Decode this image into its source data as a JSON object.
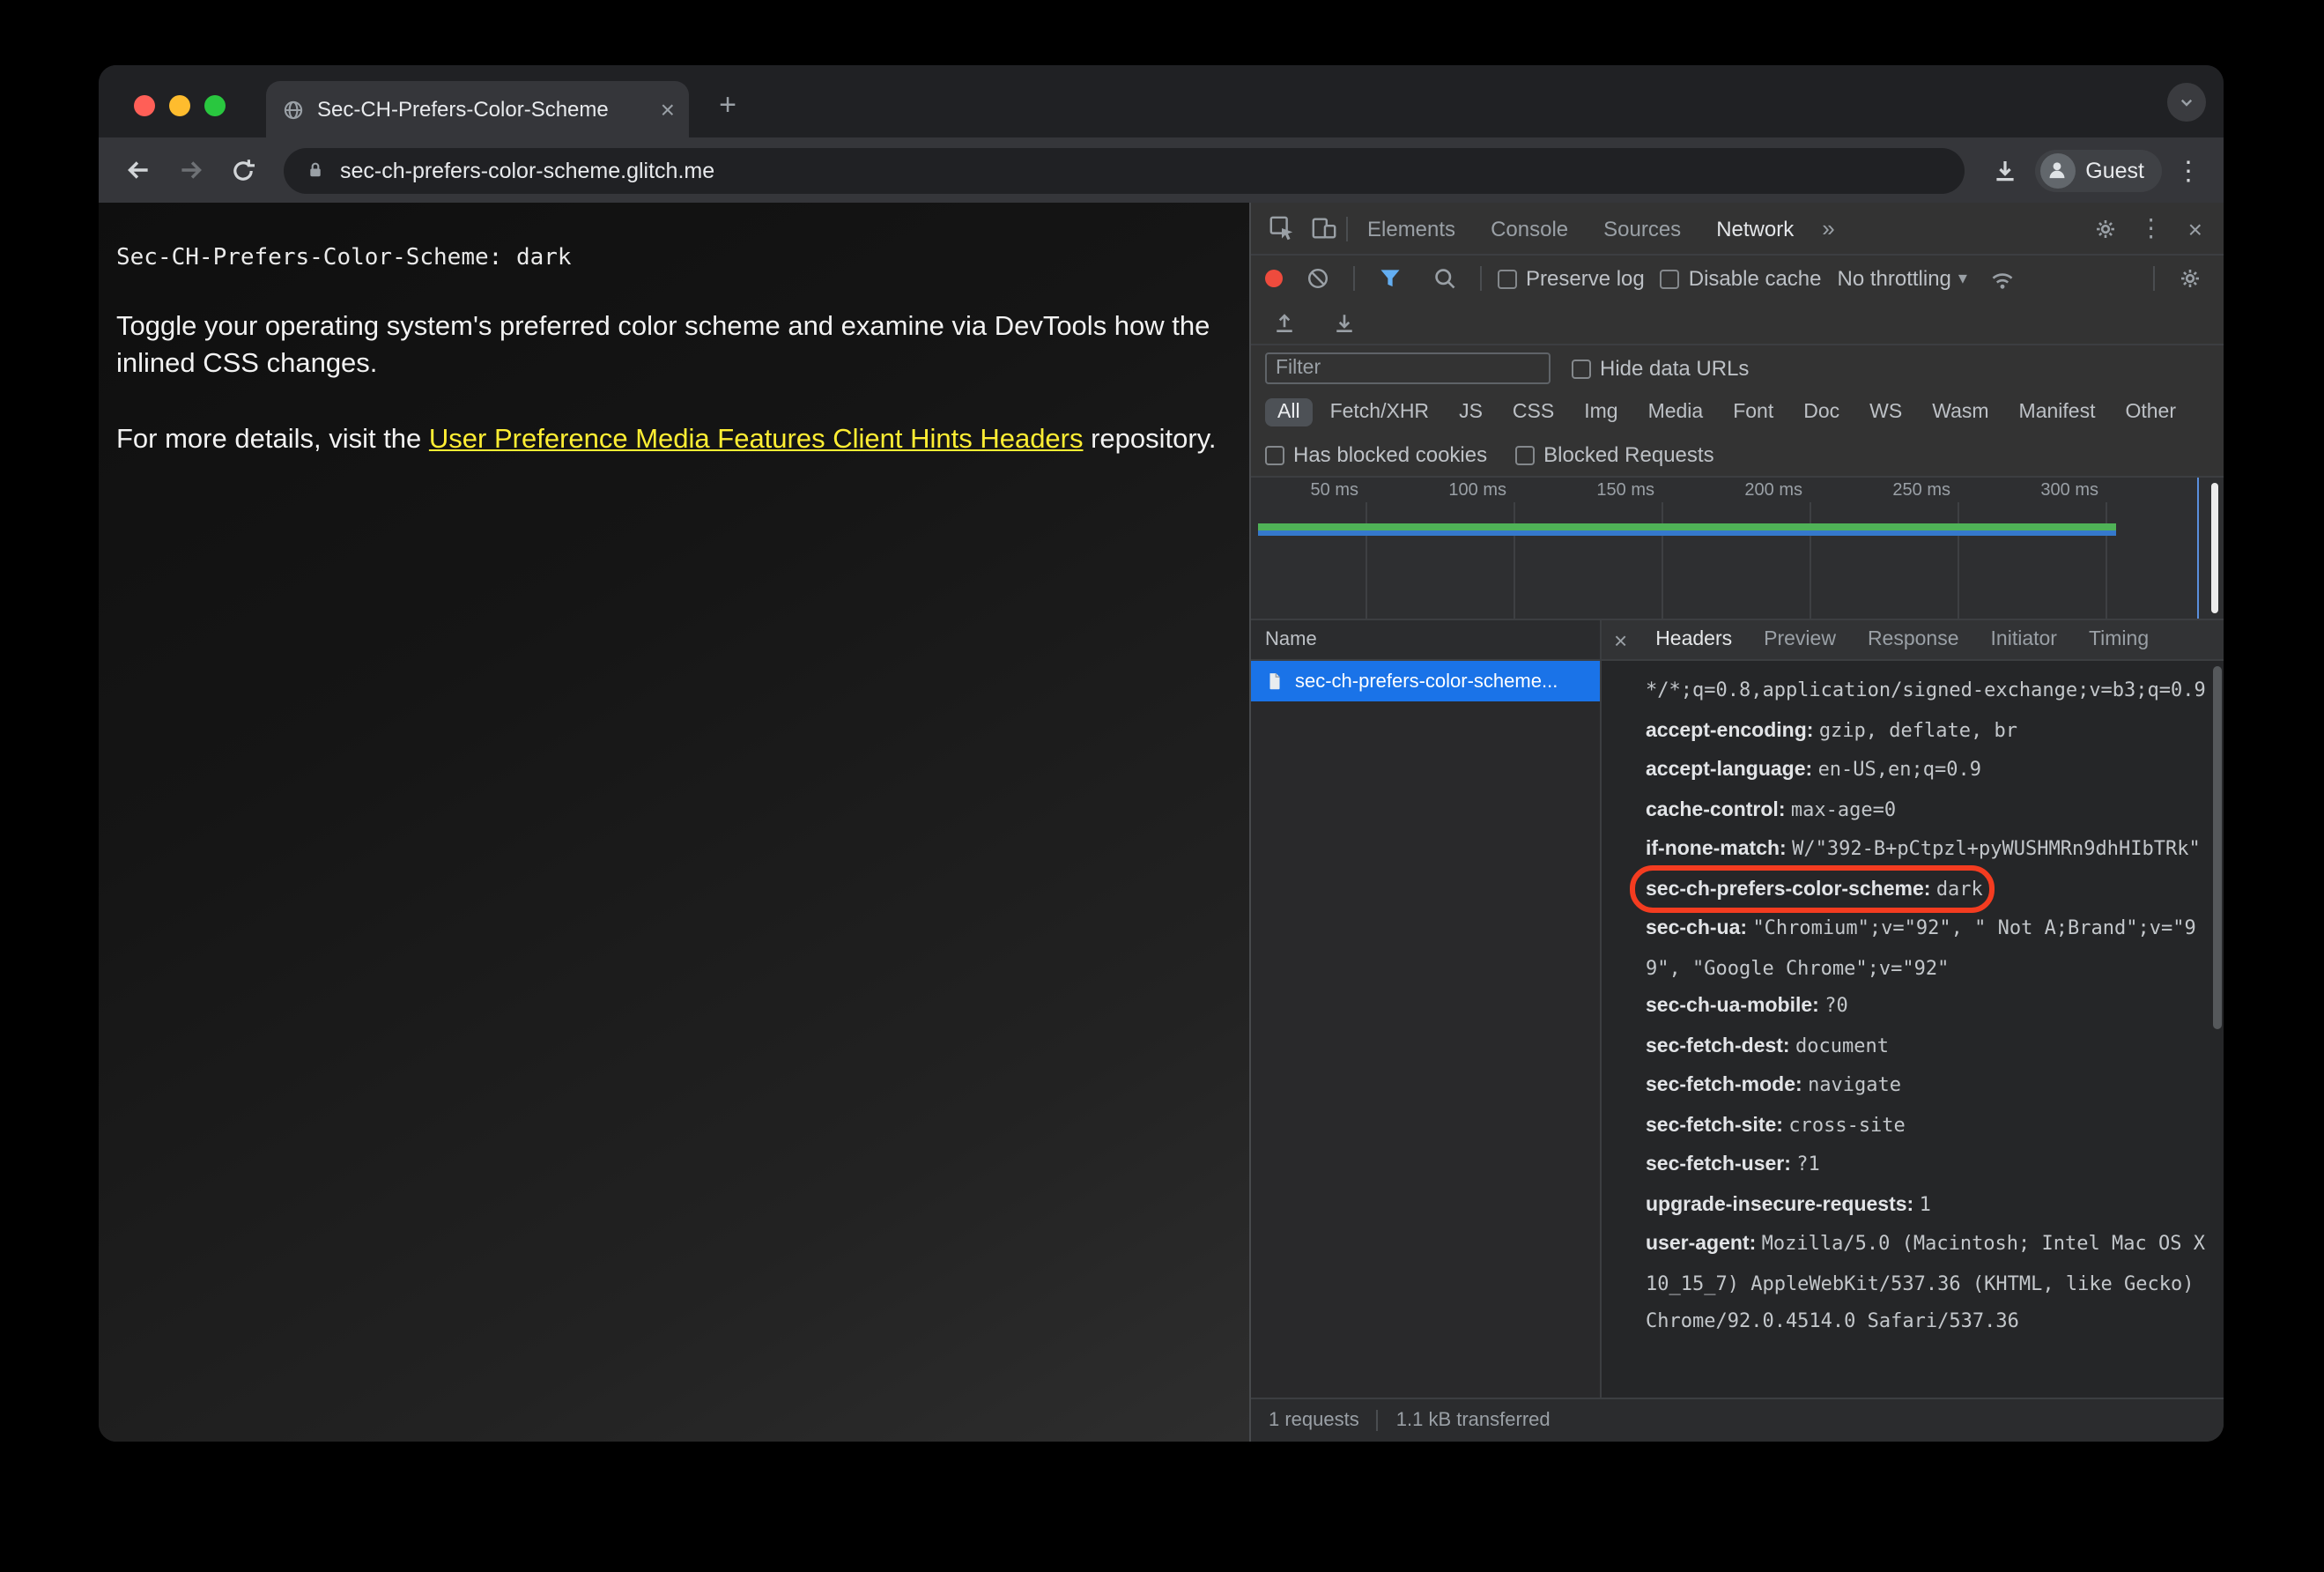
{
  "browser": {
    "tab_title": "Sec-CH-Prefers-Color-Scheme",
    "url": "sec-ch-prefers-color-scheme.glitch.me",
    "profile_label": "Guest"
  },
  "glyphs": {
    "close": "×",
    "plus": "+",
    "kebab": "⋮",
    "more_tabs": "»",
    "caret_down": "▾"
  },
  "page": {
    "heading_mono": "Sec-CH-Prefers-Color-Scheme: dark",
    "para1": "Toggle your operating system's preferred color scheme and examine via DevTools how the inlined CSS changes.",
    "para2_prefix": "For more details, visit the ",
    "para2_link": "User Preference Media Features Client Hints Headers",
    "para2_suffix": " repository."
  },
  "devtools": {
    "tabs": [
      "Elements",
      "Console",
      "Sources",
      "Network"
    ],
    "net": {
      "preserve_log": "Preserve log",
      "disable_cache": "Disable cache",
      "throttling": "No throttling",
      "filter_placeholder": "Filter",
      "hide_data_urls": "Hide data URLs",
      "has_blocked_cookies": "Has blocked cookies",
      "blocked_requests": "Blocked Requests",
      "pills": [
        "All",
        "Fetch/XHR",
        "JS",
        "CSS",
        "Img",
        "Media",
        "Font",
        "Doc",
        "WS",
        "Wasm",
        "Manifest",
        "Other"
      ],
      "ticks": [
        "50 ms",
        "100 ms",
        "150 ms",
        "200 ms",
        "250 ms",
        "300 ms"
      ],
      "name_column": "Name",
      "request_name": "sec-ch-prefers-color-scheme...",
      "summary_requests": "1 requests",
      "summary_transferred": "1.1 kB transferred"
    },
    "detail": {
      "tabs": [
        "Headers",
        "Preview",
        "Response",
        "Initiator",
        "Timing"
      ],
      "headers": [
        {
          "n": "",
          "v": "*/*;q=0.8,application/signed-exchange;v=b3;q=0.9"
        },
        {
          "n": "accept-encoding: ",
          "v": "gzip, deflate, br"
        },
        {
          "n": "accept-language: ",
          "v": "en-US,en;q=0.9"
        },
        {
          "n": "cache-control: ",
          "v": "max-age=0"
        },
        {
          "n": "if-none-match: ",
          "v": "W/\"392-B+pCtpzl+pyWUSHMRn9dhHIbTRk\""
        },
        {
          "n": "sec-ch-prefers-color-scheme: ",
          "v": "dark"
        },
        {
          "n": "sec-ch-ua: ",
          "v": "\"Chromium\";v=\"92\", \" Not A;Brand\";v=\"99\", \"Google Chrome\";v=\"92\""
        },
        {
          "n": "sec-ch-ua-mobile: ",
          "v": "?0"
        },
        {
          "n": "sec-fetch-dest: ",
          "v": "document"
        },
        {
          "n": "sec-fetch-mode: ",
          "v": "navigate"
        },
        {
          "n": "sec-fetch-site: ",
          "v": "cross-site"
        },
        {
          "n": "sec-fetch-user: ",
          "v": "?1"
        },
        {
          "n": "upgrade-insecure-requests: ",
          "v": "1"
        },
        {
          "n": "user-agent: ",
          "v": "Mozilla/5.0 (Macintosh; Intel Mac OS X 10_15_7) AppleWebKit/537.36 (KHTML, like Gecko) Chrome/92.0.4514.0 Safari/537.36"
        }
      ]
    }
  }
}
